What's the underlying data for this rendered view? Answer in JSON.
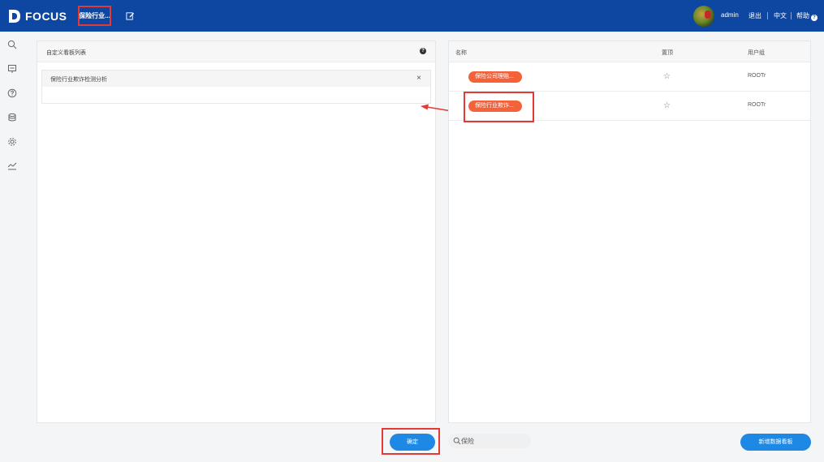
{
  "app": {
    "logo_text": "FOCUS",
    "current_tab": "保险行业..."
  },
  "user": {
    "name": "admin",
    "logout": "退出",
    "language": "中文",
    "help": "帮助",
    "help_mark": "?"
  },
  "left_panel": {
    "title": "自定义看板列表",
    "help_mark": "?",
    "items": [
      {
        "label": "保险行业欺诈检测分析",
        "close": "×"
      }
    ]
  },
  "right_panel": {
    "columns": {
      "name": "名称",
      "pin": "置顶",
      "group": "用户组"
    },
    "rows": [
      {
        "name": "保险公司理赔...",
        "star": "☆",
        "group": "ROOTr"
      },
      {
        "name": "保险行业欺诈...",
        "star": "☆",
        "group": "ROOTr"
      }
    ]
  },
  "footer": {
    "confirm_label": "确定",
    "search_value": "保险",
    "new_dashboard_label": "新增数据看板"
  },
  "colors": {
    "topbar": "#0d47a1",
    "pill": "#f4623a",
    "primary_button": "#1e88e5",
    "highlight": "#e53935"
  }
}
